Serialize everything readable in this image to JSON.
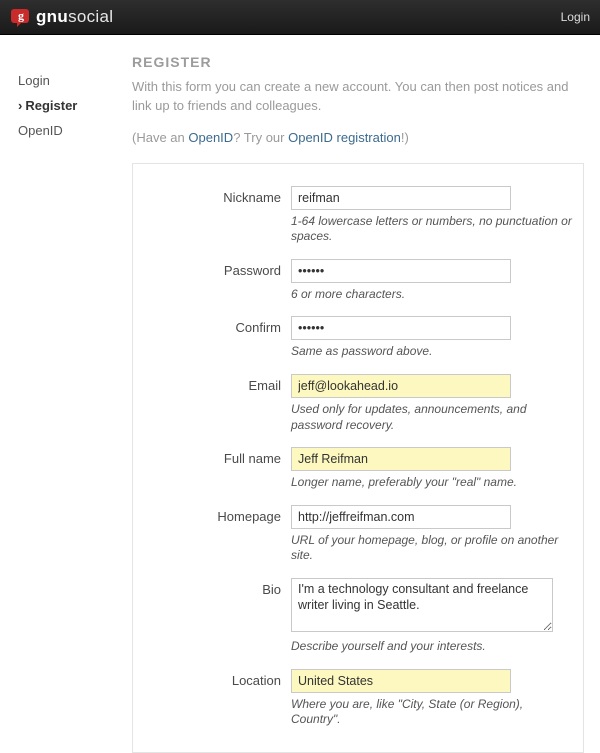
{
  "top": {
    "brand_bold": "gnu",
    "brand_light": "social",
    "login": "Login"
  },
  "sidebar": {
    "login": "Login",
    "register": "Register",
    "openid": "OpenID"
  },
  "header": {
    "title": "REGISTER",
    "intro": "With this form you can create a new account. You can then post notices and link up to friends and colleagues.",
    "openid_pre": "(Have an ",
    "openid_a1": "OpenID",
    "openid_mid": "? Try our ",
    "openid_a2": "OpenID registration",
    "openid_post": "!)"
  },
  "f": {
    "nickname": {
      "label": "Nickname",
      "value": "reifman",
      "hint": "1-64 lowercase letters or numbers, no punctuation or spaces."
    },
    "password": {
      "label": "Password",
      "value": "••••••",
      "hint": "6 or more characters."
    },
    "confirm": {
      "label": "Confirm",
      "value": "••••••",
      "hint": "Same as password above."
    },
    "email": {
      "label": "Email",
      "value": "jeff@lookahead.io",
      "hint": "Used only for updates, announcements, and password recovery."
    },
    "fullname": {
      "label": "Full name",
      "value": "Jeff Reifman",
      "hint": "Longer name, preferably your \"real\" name."
    },
    "homepage": {
      "label": "Homepage",
      "value": "http://jeffreifman.com",
      "hint": "URL of your homepage, blog, or profile on another site."
    },
    "bio": {
      "label": "Bio",
      "value": "I'm a technology consultant and freelance writer living in Seattle.",
      "hint": "Describe yourself and your interests."
    },
    "location": {
      "label": "Location",
      "value": "United States",
      "hint": "Where you are, like \"City, State (or Region), Country\"."
    }
  }
}
